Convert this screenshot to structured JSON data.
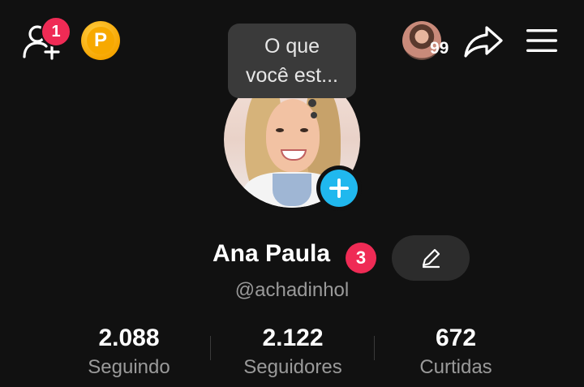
{
  "header": {
    "notification_count": "1",
    "coin_letter": "P",
    "friends_count": "99"
  },
  "tooltip": {
    "text_line1": "O que",
    "text_line2": "você est..."
  },
  "profile": {
    "name": "Ana Paula",
    "name_badge": "3",
    "handle": "@achadinhol"
  },
  "stats": [
    {
      "value": "2.088",
      "label": "Seguindo"
    },
    {
      "value": "2.122",
      "label": "Seguidores"
    },
    {
      "value": "672",
      "label": "Curtidas"
    }
  ],
  "colors": {
    "background": "#111111",
    "accent_red": "#ef2b55",
    "accent_blue": "#20b8ee",
    "coin_gold": "#f7a900"
  }
}
